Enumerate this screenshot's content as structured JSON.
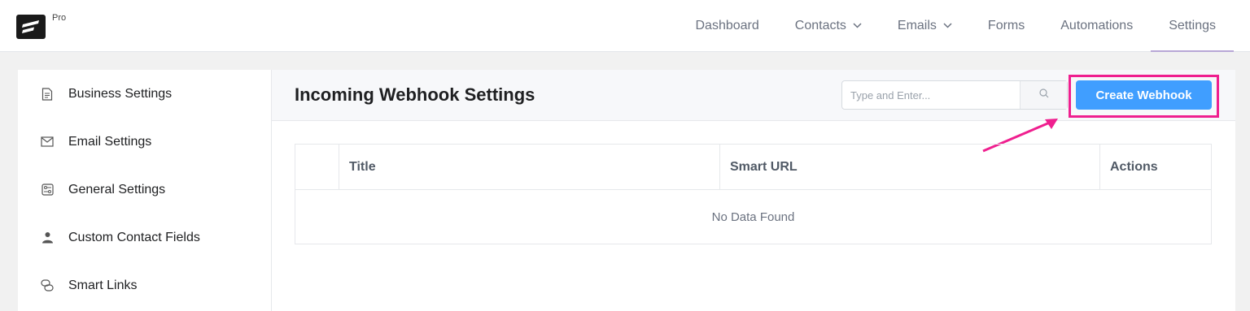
{
  "brand": {
    "tag": "Pro",
    "logo_icon": "fluentcrm-logo-icon"
  },
  "nav": {
    "items": [
      {
        "label": "Dashboard",
        "dropdown": false
      },
      {
        "label": "Contacts",
        "dropdown": true
      },
      {
        "label": "Emails",
        "dropdown": true
      },
      {
        "label": "Forms",
        "dropdown": false
      },
      {
        "label": "Automations",
        "dropdown": false
      },
      {
        "label": "Settings",
        "dropdown": false,
        "active": true
      }
    ]
  },
  "sidebar": {
    "items": [
      {
        "label": "Business Settings",
        "icon": "document-icon"
      },
      {
        "label": "Email Settings",
        "icon": "envelope-icon"
      },
      {
        "label": "General Settings",
        "icon": "sliders-icon"
      },
      {
        "label": "Custom Contact Fields",
        "icon": "user-icon"
      },
      {
        "label": "Smart Links",
        "icon": "link-icon"
      }
    ]
  },
  "main": {
    "title": "Incoming Webhook Settings",
    "search": {
      "placeholder": "Type and Enter...",
      "value": ""
    },
    "create_button": "Create Webhook",
    "table": {
      "columns": [
        "",
        "Title",
        "Smart URL",
        "Actions"
      ],
      "empty_text": "No Data Found"
    }
  },
  "colors": {
    "accent": "#409eff",
    "highlight": "#ef1f8f",
    "active_tab_underline": "#b7a7d6"
  }
}
